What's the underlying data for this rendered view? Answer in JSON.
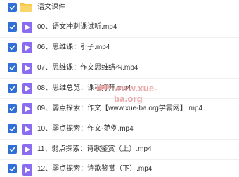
{
  "folder": {
    "name": "语文课件",
    "checked": true,
    "icon": "folder-icon"
  },
  "files": [
    {
      "name": "00、语文冲刺课试听.mp4",
      "checked": true
    },
    {
      "name": "06、思维课：引子.mp4",
      "checked": true
    },
    {
      "name": "07、思维课：作文思维结构.mp4",
      "checked": true
    },
    {
      "name": "08、思维总览：课程打开.mp4",
      "checked": true
    },
    {
      "name": "09、弱点探索：作文【www.xue-ba.org学霸网】.mp4",
      "checked": true
    },
    {
      "name": "10、弱点探索：作文-范例.mp4",
      "checked": true
    },
    {
      "name": "11、弱点探索：诗歌鉴赏（上）.mp4",
      "checked": true
    },
    {
      "name": "12、弱点探索：诗歌鉴赏（下）.mp4",
      "checked": true
    }
  ],
  "watermark": {
    "text": "www.xue-ba.org"
  },
  "colors": {
    "checkbox": "#2f6fd6",
    "video_icon": "#8a6cf0",
    "folder": "#f7c548",
    "watermark": "#e89a9a"
  }
}
